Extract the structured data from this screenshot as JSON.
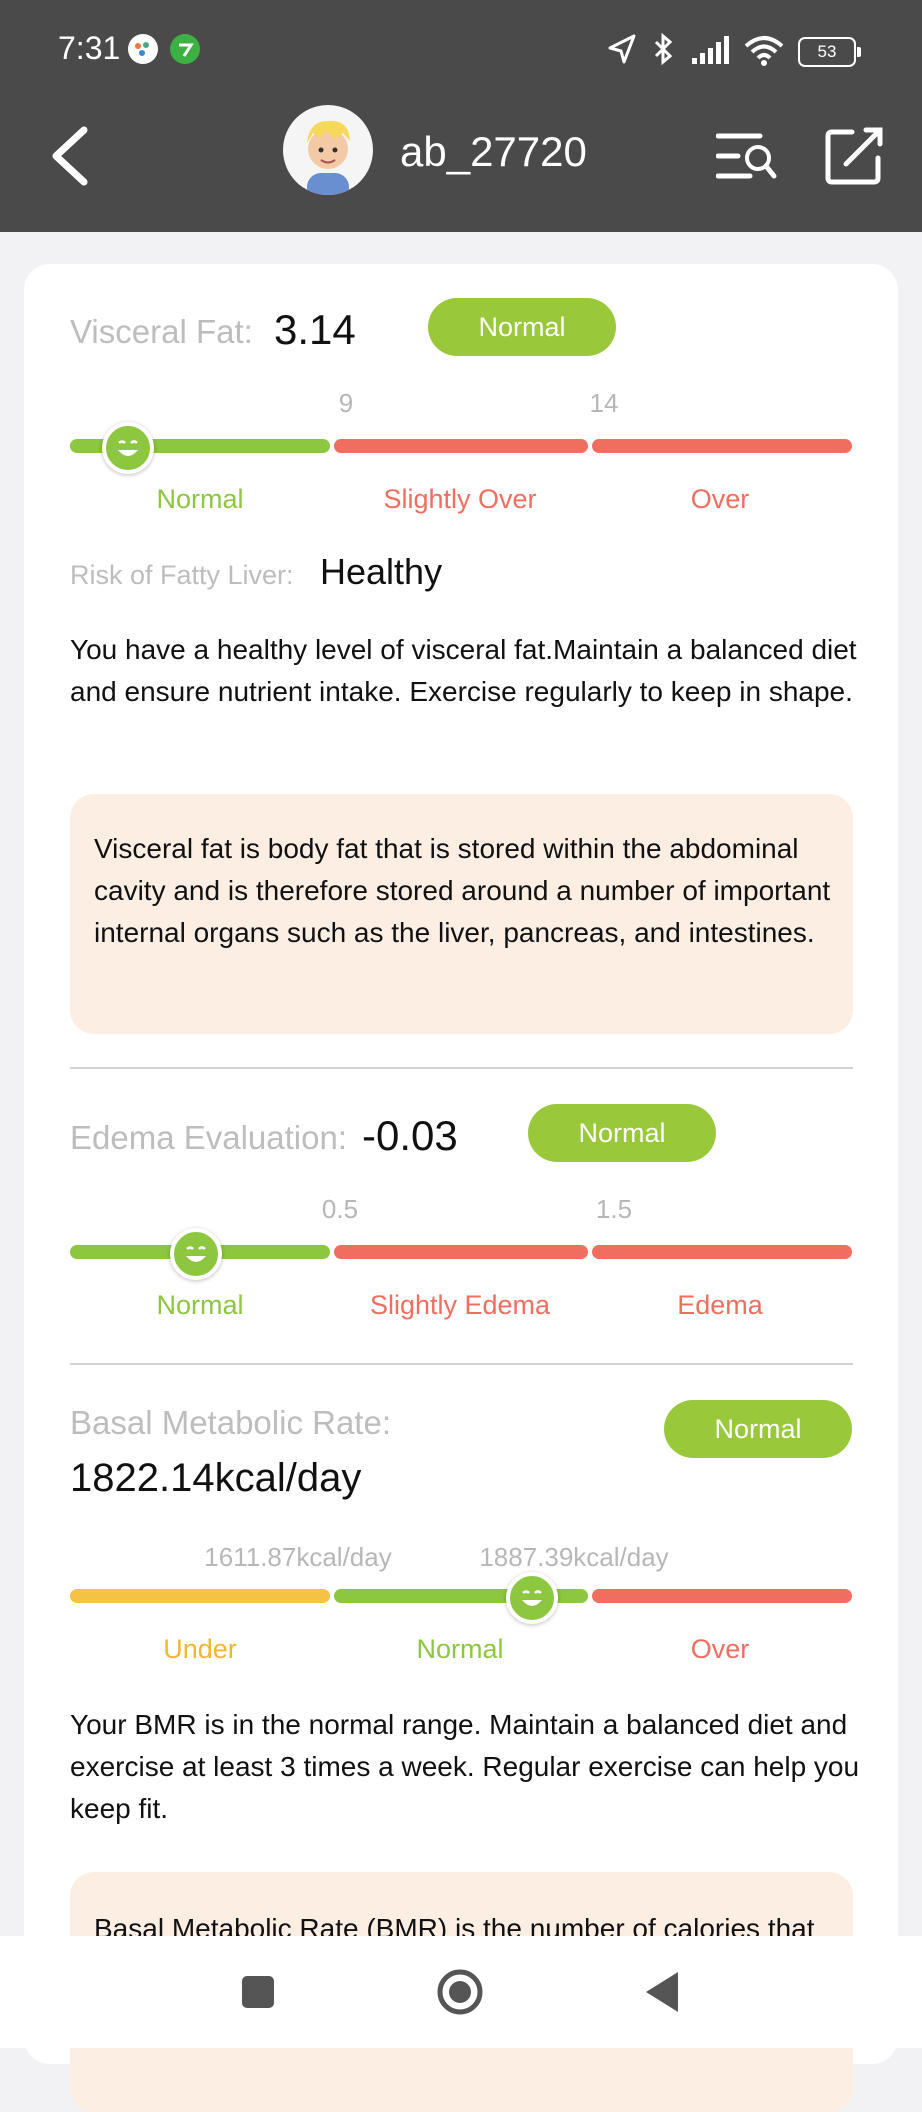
{
  "status_bar": {
    "time": "7:31",
    "battery": "53"
  },
  "header": {
    "username": "ab_27720"
  },
  "visceral": {
    "label": "Visceral Fat:",
    "value": "3.14",
    "badge": "Normal",
    "ticks": [
      "9",
      "14"
    ],
    "zones": [
      "Normal",
      "Slightly Over",
      "Over"
    ],
    "risk_label": "Risk of Fatty Liver:",
    "risk_value": "Healthy",
    "advice": "You have a healthy level of visceral fat.Maintain a balanced diet and ensure nutrient intake. Exercise regularly to keep in shape.",
    "info": "Visceral fat is body fat that is stored within the abdominal cavity and is therefore stored around a number of important internal organs such as the liver, pancreas, and intestines."
  },
  "edema": {
    "label": "Edema Evaluation:",
    "value": "-0.03",
    "badge": "Normal",
    "ticks": [
      "0.5",
      "1.5"
    ],
    "zones": [
      "Normal",
      "Slightly Edema",
      "Edema"
    ]
  },
  "bmr": {
    "label": "Basal Metabolic Rate:",
    "value": "1822.14kcal/day",
    "badge": "Normal",
    "ticks": [
      "1611.87kcal/day",
      "1887.39kcal/day"
    ],
    "zones": [
      "Under",
      "Normal",
      "Over"
    ],
    "advice": "Your BMR is in the normal range. Maintain a balanced diet and exercise at least 3 times a week. Regular exercise can help you keep fit.",
    "info": "Basal Metabolic Rate (BMR) is the number of calories that"
  },
  "colors": {
    "normal": "#8dc63f",
    "over": "#ef6e60",
    "under": "#f6c244",
    "header_bg": "#4a4a4a",
    "info_bg": "#fdeee4"
  },
  "icons": [
    "back-arrow-icon",
    "search-list-icon",
    "edit-icon",
    "smiley-indicator-icon",
    "home-square-icon",
    "home-circle-icon",
    "back-triangle-icon"
  ]
}
